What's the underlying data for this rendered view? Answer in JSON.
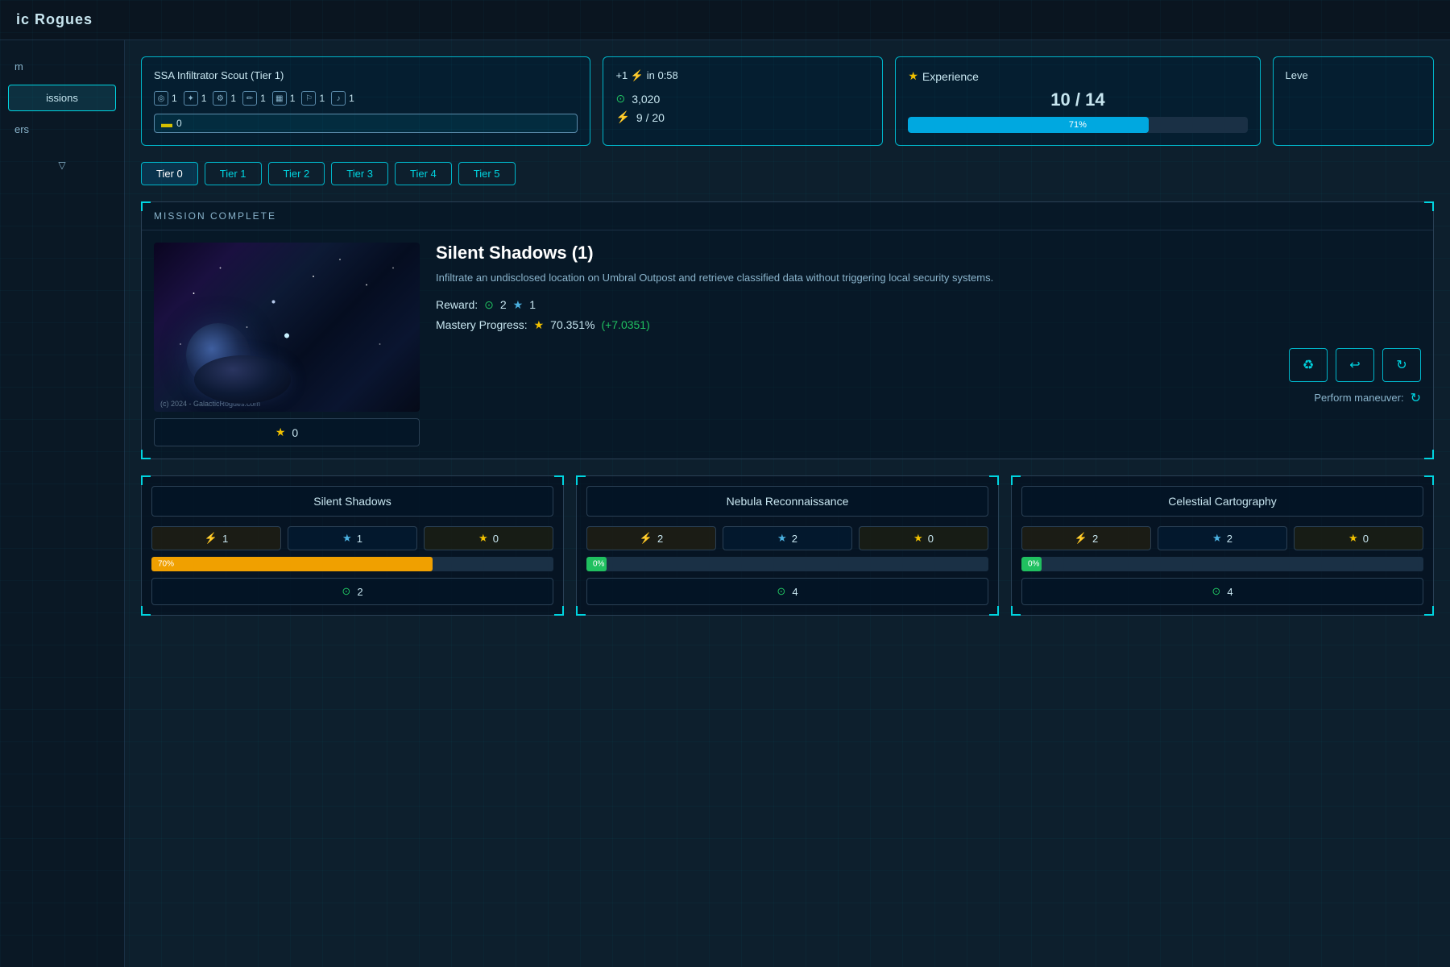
{
  "app": {
    "title": "ic Rogues"
  },
  "sidebar": {
    "items": [
      {
        "label": "m",
        "active": false
      },
      {
        "label": "issions",
        "active": true
      }
    ],
    "sub_items": [
      {
        "label": "ers",
        "active": false
      }
    ],
    "chevron": "▽"
  },
  "agent_card": {
    "title": "SSA Infiltrator Scout (Tier 1)",
    "skills": [
      {
        "icon": "◎",
        "value": "1"
      },
      {
        "icon": "✦",
        "value": "1"
      },
      {
        "icon": "⚙",
        "value": "1"
      },
      {
        "icon": "✏",
        "value": "1"
      },
      {
        "icon": "▦",
        "value": "1"
      },
      {
        "icon": "⚐",
        "value": "1"
      },
      {
        "icon": "♪",
        "value": "1"
      }
    ],
    "battery": "0"
  },
  "resources_card": {
    "timer_label": "+1",
    "timer_icon": "⚡",
    "timer_value": "in 0:58",
    "credits_icon": "⊙",
    "credits_value": "3,020",
    "energy_icon": "⚡",
    "energy_current": "9",
    "energy_max": "20"
  },
  "experience_card": {
    "label": "Experience",
    "current": "10",
    "max": "14",
    "display": "10 / 14",
    "percent": 71,
    "percent_label": "71%"
  },
  "level_card": {
    "label": "Leve"
  },
  "tier_tabs": [
    {
      "label": "Tier 0",
      "active": true
    },
    {
      "label": "Tier 1",
      "active": false
    },
    {
      "label": "Tier 2",
      "active": false
    },
    {
      "label": "Tier 3",
      "active": false
    },
    {
      "label": "Tier 4",
      "active": false
    },
    {
      "label": "Tier 5",
      "active": false
    }
  ],
  "mission_complete": {
    "header": "MISSION COMPLETE",
    "title": "Silent Shadows (1)",
    "description": "Infiltrate an undisclosed location on Umbral Outpost and retrieve classified data without triggering local security systems.",
    "reward_label": "Reward:",
    "reward_credits": "2",
    "reward_xp": "1",
    "mastery_label": "Mastery Progress:",
    "mastery_percent": "70.351%",
    "mastery_bonus": "(+7.0351)",
    "star_rating": "0",
    "copyright": "(c) 2024 - GalacticRogues.com",
    "maneuver_label": "Perform maneuver:",
    "buttons": [
      {
        "icon": "♻",
        "label": "recycle"
      },
      {
        "icon": "↩",
        "label": "repeat"
      },
      {
        "icon": "↻",
        "label": "refresh"
      }
    ]
  },
  "mission_cards": [
    {
      "title": "Silent Shadows",
      "energy": "1",
      "xp": "1",
      "gold": "0",
      "progress_percent": 70,
      "progress_label": "70%",
      "progress_color": "orange",
      "cost": "2"
    },
    {
      "title": "Nebula Reconnaissance",
      "energy": "2",
      "xp": "2",
      "gold": "0",
      "progress_percent": 0,
      "progress_label": "0%",
      "progress_color": "green",
      "cost": "4"
    },
    {
      "title": "Celestial Cartography",
      "energy": "2",
      "xp": "2",
      "gold": "0",
      "progress_percent": 0,
      "progress_label": "0%",
      "progress_color": "green",
      "cost": "4"
    }
  ],
  "colors": {
    "accent": "#00d4e0",
    "accent_dark": "#00b4c8",
    "bg_dark": "#0a1520",
    "bg_medium": "#0d1f2d",
    "gold": "#f0c000",
    "green": "#20c060",
    "energy_color": "#f0c000",
    "xp_color": "#4ab0e0",
    "orange": "#f0a000"
  }
}
